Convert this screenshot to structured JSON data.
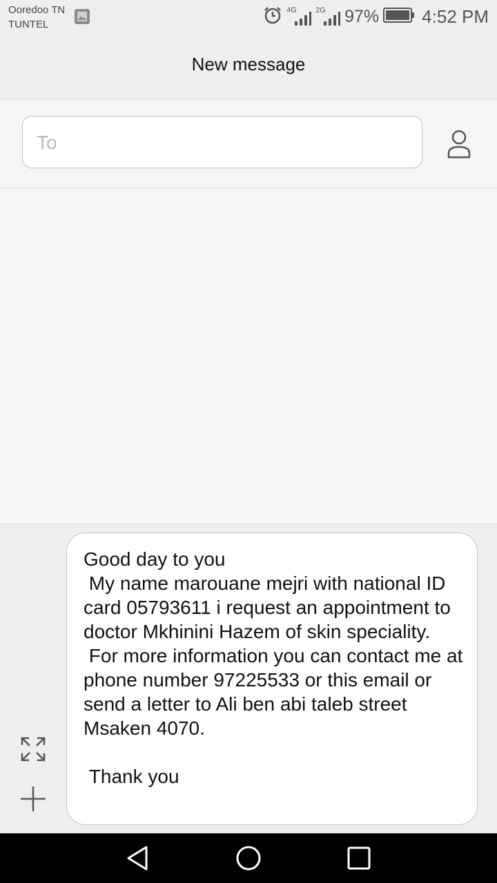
{
  "status_bar": {
    "carrier_1": "Ooredoo TN",
    "carrier_2": "TUNTEL",
    "network_1": "4G",
    "network_2": "2G",
    "battery": "97%",
    "time": "4:52 PM"
  },
  "header": {
    "title": "New message"
  },
  "recipient": {
    "placeholder": "To",
    "contact_icon": "person-icon"
  },
  "compose": {
    "message": "Good day to you\n My name marouane mejri with national ID card 05793611 i request an appointment to doctor Mkhinini Hazem of skin speciality.\n For more information you can contact me at phone number 97225533 or this email or send a letter to Ali ben abi taleb street Msaken 4070.\n\n Thank you",
    "expand_icon": "expand-icon",
    "add_icon": "plus-icon"
  },
  "nav_bar": {
    "back_icon": "back-triangle-icon",
    "home_icon": "home-circle-icon",
    "recents_icon": "recents-square-icon"
  }
}
